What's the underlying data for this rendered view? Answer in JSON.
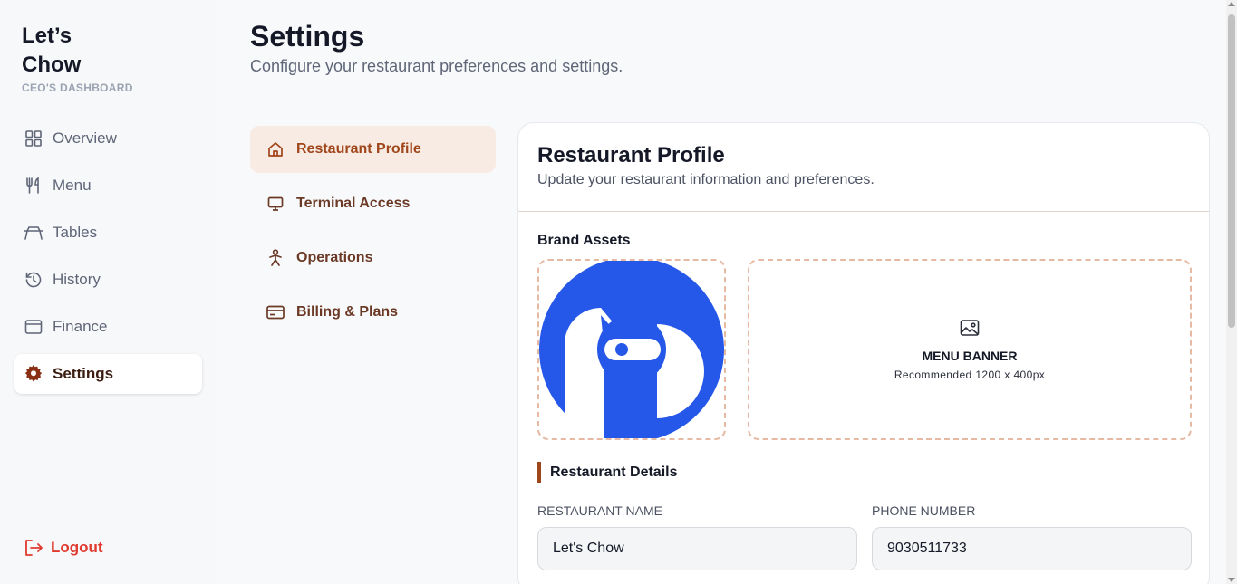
{
  "brand": {
    "name": "Let’s Chow",
    "subtitle": "CEO'S DASHBOARD"
  },
  "sidebar": {
    "items": [
      {
        "label": "Overview",
        "icon": "grid-icon"
      },
      {
        "label": "Menu",
        "icon": "utensils-icon"
      },
      {
        "label": "Tables",
        "icon": "table-icon"
      },
      {
        "label": "History",
        "icon": "history-icon"
      },
      {
        "label": "Finance",
        "icon": "wallet-icon"
      },
      {
        "label": "Settings",
        "icon": "gear-icon",
        "active": true
      }
    ],
    "logout_label": "Logout"
  },
  "header": {
    "title": "Settings",
    "subtitle": "Configure your restaurant preferences and settings."
  },
  "settings_nav": {
    "items": [
      {
        "label": "Restaurant Profile",
        "icon": "home-icon",
        "active": true
      },
      {
        "label": "Terminal Access",
        "icon": "monitor-icon"
      },
      {
        "label": "Operations",
        "icon": "person-icon"
      },
      {
        "label": "Billing & Plans",
        "icon": "credit-card-icon"
      }
    ]
  },
  "profile": {
    "title": "Restaurant Profile",
    "subtitle": "Update your restaurant information and preferences.",
    "brand_assets_label": "Brand Assets",
    "banner_title": "MENU BANNER",
    "banner_hint": "Recommended 1200 x 400px",
    "details_label": "Restaurant Details",
    "fields": {
      "name_label": "RESTAURANT NAME",
      "name_value": "Let's Chow",
      "phone_label": "PHONE NUMBER",
      "phone_value": "9030511733"
    }
  },
  "colors": {
    "accent": "#a0461b",
    "accent_bg": "#f8ebe3",
    "logo_blue": "#2557e8",
    "logout": "#e03a2f"
  }
}
